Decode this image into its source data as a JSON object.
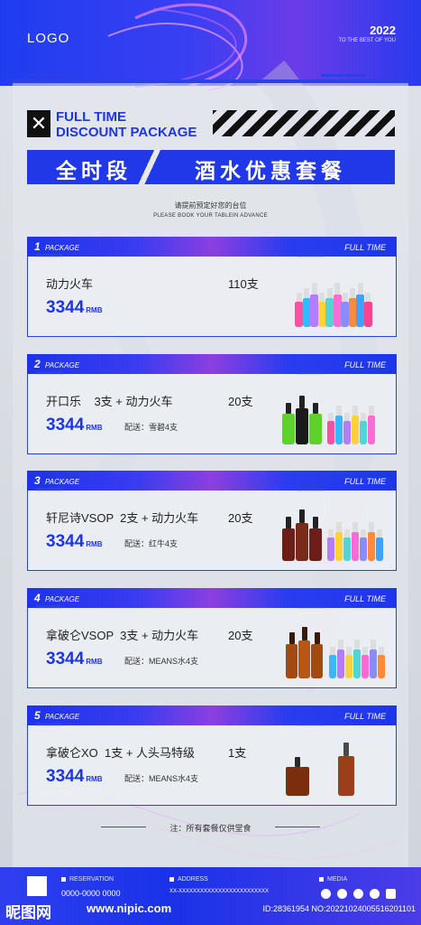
{
  "header": {
    "logo": "LOGO",
    "year": "2022",
    "tagline": "TO THE BEST OF YOU"
  },
  "headline": {
    "line1": "FULL TIME",
    "line2": "DISCOUNT PACKAGE",
    "close_glyph": "✕"
  },
  "banner": {
    "left": "全时段",
    "right": "酒水优惠套餐"
  },
  "notice": {
    "cn": "请提前预定好您的台位",
    "en": "PLEASE BOOK YOUR TABLEIN ADVANCE"
  },
  "package_label": "PACKAGE",
  "full_time_label": "FULL TIME",
  "currency": "RMB",
  "packages": [
    {
      "num": "1",
      "item": "动力火车",
      "qty": "110支",
      "price": "3344",
      "gift": "",
      "bottle_kind": "colorful"
    },
    {
      "num": "2",
      "item": "开口乐    3支 + 动力火车",
      "qty": "20支",
      "price": "3344",
      "gift": "配送：雪碧4支",
      "bottle_kind": "green-dark"
    },
    {
      "num": "3",
      "item": "轩尼诗VSOP  2支 + 动力火车",
      "qty": "20支",
      "price": "3344",
      "gift": "配送：红牛4支",
      "bottle_kind": "cognac"
    },
    {
      "num": "4",
      "item": "拿破仑VSOP  3支 + 动力火车",
      "qty": "20支",
      "price": "3344",
      "gift": "配送：MEANS水4支",
      "bottle_kind": "amber"
    },
    {
      "num": "5",
      "item": "拿破仑XO  1支 + 人头马特级",
      "qty": "1支",
      "price": "3344",
      "gift": "配送：MEANS水4支",
      "bottle_kind": "xo"
    }
  ],
  "footnote": "注：所有套餐仅供堂食",
  "footer": {
    "reservation_label": "RESERVATION",
    "reservation_value": "0000-0000 0000",
    "address_label": "ADDRESS",
    "address_value": "XX-XXXXXXXXXXXXXXXXXXXXXXXXX",
    "media_label": "MEDIA"
  },
  "watermark": {
    "brand": "昵图网",
    "url": "www.nipic.com",
    "id": "ID:28361954 NO:20221024005516201101"
  },
  "colors": {
    "brand_blue": "#1c36e8",
    "accent_purple": "#8c3fe0"
  }
}
